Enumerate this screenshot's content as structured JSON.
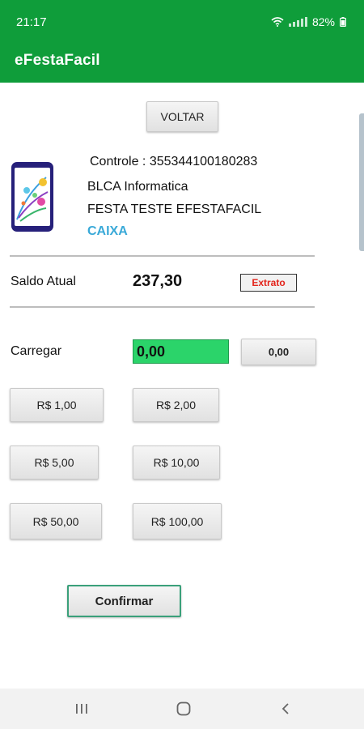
{
  "status_bar": {
    "time": "21:17",
    "battery": "82%"
  },
  "app_bar": {
    "title": "eFestaFacil"
  },
  "voltar_button": "VOLTAR",
  "info": {
    "controle": "Controle : 355344100180283",
    "company": "BLCA Informatica",
    "event": "FESTA TESTE EFESTAFACIL",
    "role": "CAIXA"
  },
  "saldo": {
    "label": "Saldo Atual",
    "value": "237,30",
    "extrato_button": "Extrato"
  },
  "carregar": {
    "label": "Carregar",
    "input_value": "0,00",
    "total_button": "0,00"
  },
  "quick_amounts": [
    "R$ 1,00",
    "R$ 2,00",
    "R$ 5,00",
    "R$ 10,00",
    "R$ 50,00",
    "R$ 100,00"
  ],
  "confirm_button": "Confirmar",
  "colors": {
    "app_bar": "#0f9d3a",
    "input_bg": "#2bd46a",
    "caixa_text": "#39a9d8",
    "extrato_text": "#e3241b"
  },
  "icons": {
    "nav_recents": "recent-apps-icon",
    "nav_home": "home-icon",
    "nav_back": "back-icon",
    "logo": "phone-fireworks-logo-icon"
  }
}
